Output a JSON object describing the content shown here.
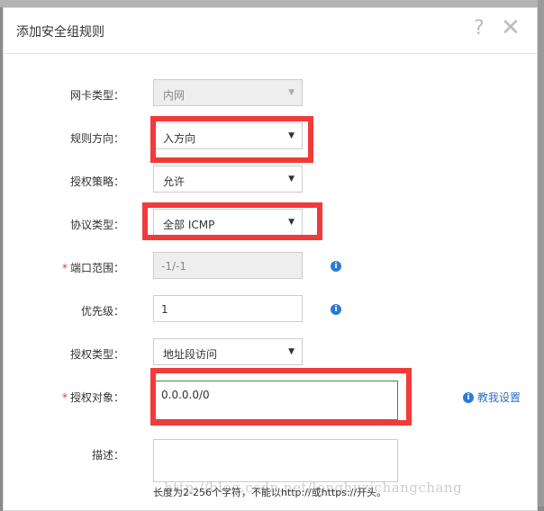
{
  "dialog": {
    "title": "添加安全组规则",
    "help_glyph": "?",
    "close_glyph": "✕"
  },
  "form": {
    "nic_type": {
      "label": "网卡类型：",
      "value": "内网"
    },
    "direction": {
      "label": "规则方向：",
      "value": "入方向"
    },
    "policy": {
      "label": "授权策略：",
      "value": "允许"
    },
    "protocol": {
      "label": "协议类型：",
      "value": "全部 ICMP"
    },
    "port_range": {
      "required_mark": "*",
      "label": "端口范围：",
      "value": "-1/-1"
    },
    "priority": {
      "label": "优先级：",
      "value": "1"
    },
    "auth_type": {
      "label": "授权类型：",
      "value": "地址段访问"
    },
    "auth_object": {
      "required_mark": "*",
      "label": "授权对象：",
      "value": "0.0.0.0/0",
      "help_link": "教我设置"
    },
    "description": {
      "label": "描述：",
      "value": "",
      "hint": "长度为2-256个字符，不能以http://或https://开头。"
    }
  },
  "watermark": "http://blog.csdn.net/longhuzichangchang",
  "icons": {
    "info": "info-icon",
    "caret": "caret-down-icon"
  },
  "colors": {
    "highlight": "#f13a3a",
    "link": "#2b6fc7",
    "info": "#2b7bd6"
  }
}
